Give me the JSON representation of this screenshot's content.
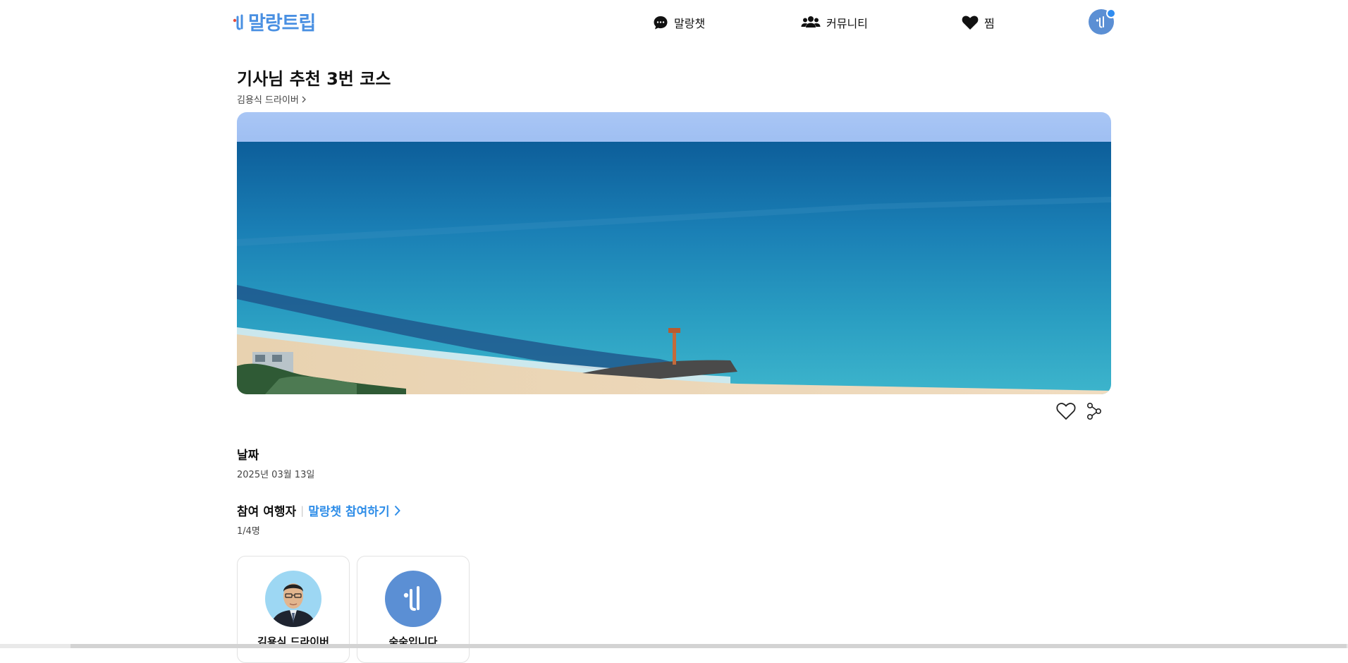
{
  "header": {
    "logo_text": "말랑트립",
    "nav": {
      "chat_label": "말랑챗",
      "community_label": "커뮤니티",
      "wish_label": "찜"
    }
  },
  "course": {
    "title": "기사님 추천 3번 코스",
    "author": "김용식 드라이버",
    "hero_alt": "sea-beach-photo"
  },
  "date_section": {
    "label": "날짜",
    "value": "2025년 03월 13일"
  },
  "participants": {
    "label": "참여 여행자",
    "join_link": "말랑챗 참여하기",
    "count": "1/4명",
    "cards": [
      {
        "name": "김용식 드라이버"
      },
      {
        "name": "숙숙입니다"
      }
    ]
  },
  "colors": {
    "brand": "#4a90e2",
    "link": "#2e8de8",
    "avatar_bg": "#5b8fd4"
  }
}
